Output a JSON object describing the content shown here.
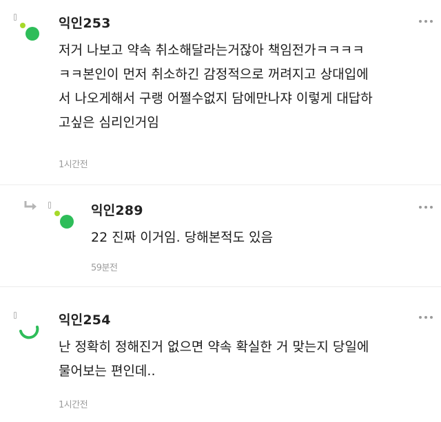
{
  "comments": [
    {
      "username": "익인253",
      "text": "저거 나보고 약속 취소해달라는거잖아 책임전가ㅋㅋㅋㅋ\nㅋㅋ본인이 먼저 취소하긴 감정적으로 꺼려지고 상대입에\n서 나오게해서 구랭 어쩔수없지 담에만나쟈 이렇게 대답하\n고싶은 심리인거임",
      "time": "1시간전",
      "avatar_color": "#2ebd59",
      "avatar_accent": "#a6d92a"
    },
    {
      "username": "익인289",
      "text": "22 진짜 이거임. 당해본적도 있음",
      "time": "59분전",
      "is_reply": true,
      "avatar_color": "#2ebd59",
      "avatar_accent": "#a6d92a"
    },
    {
      "username": "익인254",
      "text": "난 정확히 정해진거 없으면 약속 확실한 거 맞는지 당일에\n물어보는 편인데..",
      "time": "1시간전",
      "avatar_color": "#2ebd59"
    }
  ],
  "icons": {
    "more": "more-vertical-icon",
    "reply": "reply-arrow-icon"
  }
}
